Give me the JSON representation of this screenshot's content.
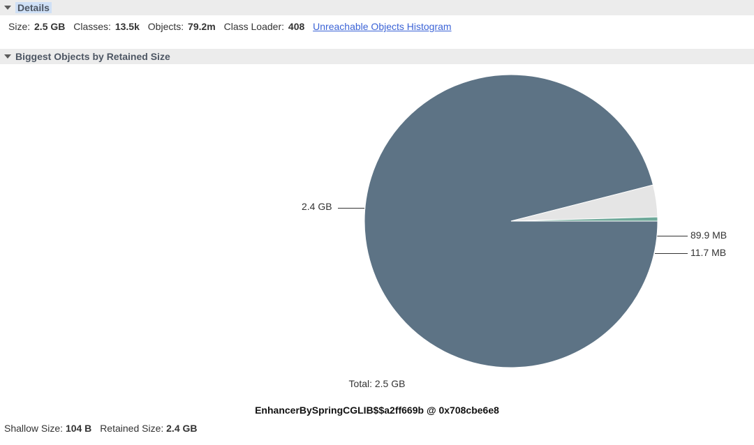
{
  "details": {
    "header": "Details",
    "size_label": "Size:",
    "size_value": "2.5 GB",
    "classes_label": "Classes:",
    "classes_value": "13.5k",
    "objects_label": "Objects:",
    "objects_value": "79.2m",
    "classloader_label": "Class Loader:",
    "classloader_value": "408",
    "link_text": "Unreachable Objects Histogram"
  },
  "biggest": {
    "header": "Biggest Objects by Retained Size",
    "total_label": "Total: 2.5 GB",
    "selected_object": "EnhancerBySpringCGLIB$$a2ff669b @ 0x708cbe6e8",
    "labels": {
      "s0": "2.4 GB",
      "s1": "89.9 MB",
      "s2": "11.7 MB"
    }
  },
  "sizes": {
    "shallow_label": "Shallow Size:",
    "shallow_value": "104 B",
    "retained_label": "Retained Size:",
    "retained_value": "2.4 GB"
  },
  "chart_data": {
    "type": "pie",
    "title": "Biggest Objects by Retained Size",
    "total_label": "Total: 2.5 GB",
    "series": [
      {
        "name": "2.4 GB",
        "value_bytes": 2576980378,
        "display": "2.4 GB",
        "color": "#5d7385"
      },
      {
        "name": "89.9 MB",
        "value_bytes": 94266982,
        "display": "89.9 MB",
        "color": "#e5e5e5"
      },
      {
        "name": "11.7 MB",
        "value_bytes": 12268339,
        "display": "11.7 MB",
        "color": "#6fa99a"
      }
    ]
  }
}
